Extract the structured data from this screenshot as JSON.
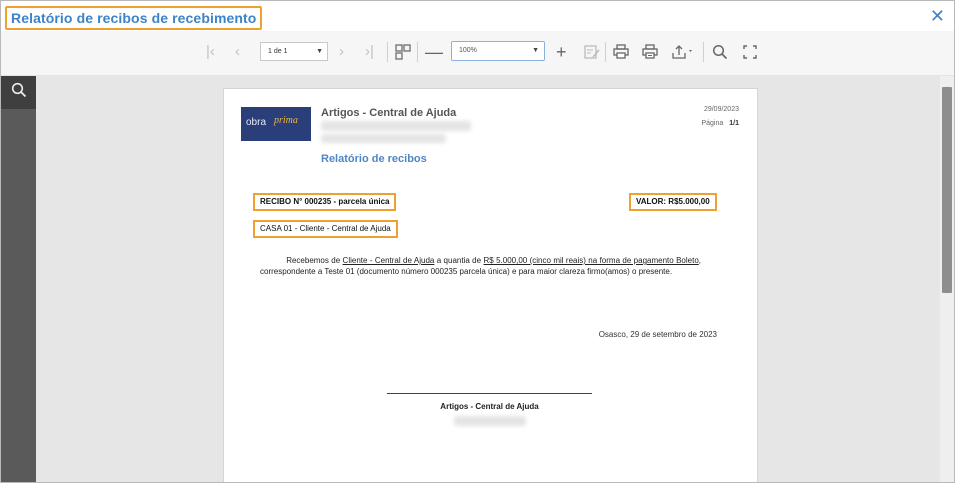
{
  "window": {
    "title": "Relatório de recibos de recebimento",
    "close_icon": "close-icon"
  },
  "toolbar": {
    "page_select_value": "1 de 1",
    "zoom_value": "100%",
    "icons": [
      "first-page-icon",
      "prev-page-icon",
      "next-page-icon",
      "last-page-icon",
      "multipage-icon",
      "zoom-out-icon",
      "zoom-in-icon",
      "highlight-icon",
      "print-icon",
      "print-page-icon",
      "export-icon",
      "search-icon",
      "fullscreen-icon"
    ]
  },
  "report": {
    "company": "Artigos - Central de Ajuda",
    "date": "29/09/2023",
    "page_label": "Página",
    "page_value": "1/1",
    "title": "Relatório de recibos",
    "logo_text_1": "obra",
    "logo_text_2": "prima",
    "recibo": "RECIBO N° 000235 - parcela única",
    "valor": "VALOR: R$5.000,00",
    "casa": "CASA 01 - Cliente - Central de Ajuda",
    "para_part1": "Recebemos de ",
    "para_client": "Cliente - Central de Ajuda",
    "para_part2": " a quantia de ",
    "para_amount": "R$ 5.000,00 (cinco mil reais) na forma de pagamento Boleto",
    "para_part3": ", correspondente a Teste 01 (documento número 000235 parcela única) e para maior clareza firmo(amos) o presente.",
    "city_date": "Osasco, 29 de setembro de 2023",
    "signature_name": "Artigos - Central de Ajuda"
  },
  "colors": {
    "accent": "#3d83c8",
    "highlight": "#f0a030",
    "logo_bg": "#2a3e7a"
  }
}
